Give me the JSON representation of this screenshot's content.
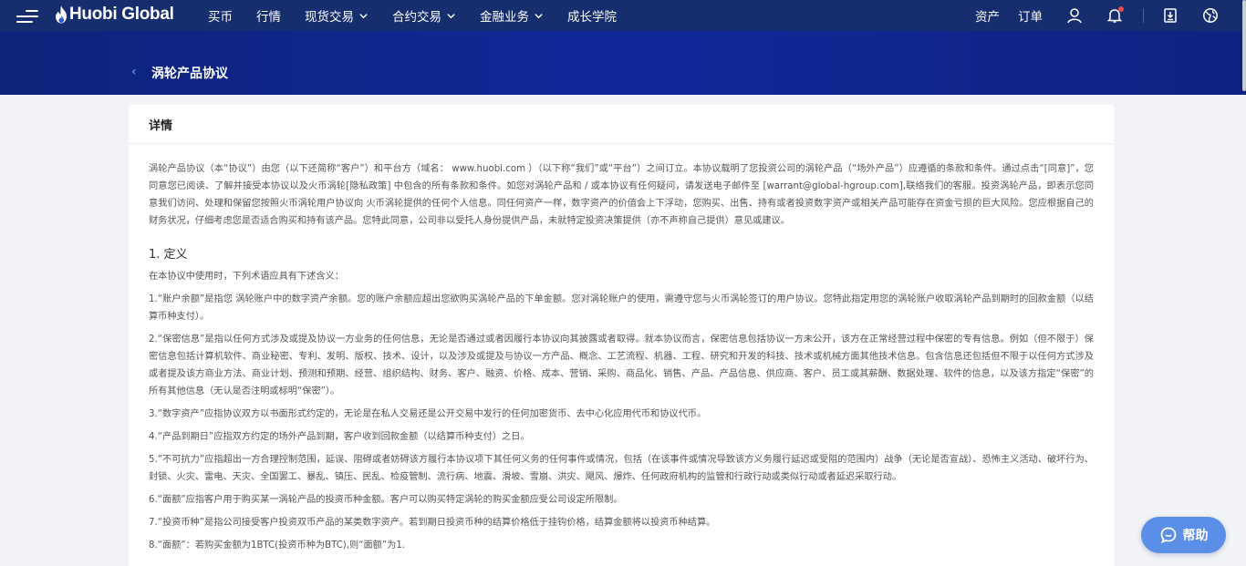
{
  "header": {
    "logo_text": "Huobi Global",
    "nav": [
      {
        "label": "买币",
        "has_dropdown": false
      },
      {
        "label": "行情",
        "has_dropdown": false
      },
      {
        "label": "现货交易",
        "has_dropdown": true
      },
      {
        "label": "合约交易",
        "has_dropdown": true
      },
      {
        "label": "金融业务",
        "has_dropdown": true
      },
      {
        "label": "成长学院",
        "has_dropdown": false
      }
    ],
    "right": {
      "assets": "资产",
      "orders": "订单"
    },
    "icons": [
      "user-icon",
      "bell-icon",
      "download-icon",
      "globe-icon"
    ]
  },
  "banner": {
    "back_icon": "‹",
    "title": "涡轮产品协议"
  },
  "card": {
    "heading": "详情",
    "intro": "涡轮产品协议（本“协议”）由您（以下还简称“客户”）和平台方（域名： www.huobi.com ）（以下称“我们”或“平台”）之间订立。本协议载明了您投资公司的涡轮产品（“场外产品”）应遵循的条款和条件。通过点击“[同意]”，您同意您已阅读、了解并接受本协议以及火币涡轮[隐私政策] 中包含的所有条款和条件。如您对涡轮产品和 / 或本协议有任何疑问，请发送电子邮件至 [warrant@global-hgroup.com],联络我们的客服。投资涡轮产品，即表示您同意我们访问、处理和保留您按照火币涡轮用户协议向 火币涡轮提供的任何个人信息。同任何资产一样，数字资产的价值会上下浮动，您购买、出售、持有或者投资数字资产或相关产品可能存在资金亏损的巨大风险。您应根据自己的财务状况，仔细考虑您是否适合购买和持有该产品。您特此同意，公司非以受托人身份提供产品，未就特定投资决策提供（亦不声称自己提供）意见或建议。",
    "section_title": "1. 定义",
    "section_lead": "在本协议中使用时，下列术语应具有下述含义：",
    "items": [
      "1.“账户余额”是指您 涡轮账户中的数字资产余额。您的账户余额应超出您欲购买涡轮产品的下单金额。您对涡轮账户的使用，需遵守您与火币涡轮签订的用户协议。您特此指定用您的涡轮账户收取涡轮产品到期时的回款金额（以结算币种支付）。",
      "2.“保密信息”是指以任何方式涉及或提及协议一方业务的任何信息，无论是否通过或者因履行本协议向其披露或者取得。就本协议而言，保密信息包括协议一方未公开，该方在正常经营过程中保密的专有信息。例如（但不限于）保密信息包括计算机软件、商业秘密、专利、发明、版权、技术、设计，以及涉及或提及与协议一方产品、概念、工艺流程、机器、工程、研究和开发的科技、技术或机械方面其他技术信息。包含信息还包括但不限于以任何方式涉及或者提及该方商业方法、商业计划、预测和预期、经营、组织结构、财务、客户、融资、价格、成本、营销、采购、商品化、销售、产品、产品信息、供应商、客户、员工或其薪酬、数据处理、软件的信息，以及该方指定“保密”的所有其他信息（无认是否注明或标明“保密”）。",
      "3.“数字资产”应指协议双方以书面形式约定的，无论是在私人交易还是公开交易中发行的任何加密货币、去中心化应用代币和协议代币。",
      "4.“产品到期日”应指双方约定的场外产品到期，客户收到回款金额（以结算币种支付）之日。",
      "5.“不可抗力”应指超出一方合理控制范围，延误、阻碍或者妨碍该方履行本协议项下其任何义务的任何事件或情况，包括（在该事件或情况导致该方义务履行延迟或受阻的范围内）战争（无论是否宣战）、恐怖主义活动、破坏行为、封锁、火灾、雷电、天灾、全国罢工、暴乱、镇压、民乱、检疫管制、流行病、地震、滑坡、雪崩、洪灾、飓风、爆炸、任何政府机构的监管和行政行动或类似行动或者延迟采取行动。",
      "6.“面额”应指客户用于购买某一涡轮产品的投资币种金额。客户可以购买特定涡轮的购买金额应受公司设定所限制。",
      "7.“投资币种”是指公司接受客户投资双币产品的某类数字资产。若到期日投资币种的结算价格低于挂钩价格，结算金额将以投资币种结算。",
      "8.“面额”：若购买金额为1BTC(投资币种为BTC),则“面额”为1."
    ]
  },
  "help": {
    "label": "帮助"
  }
}
